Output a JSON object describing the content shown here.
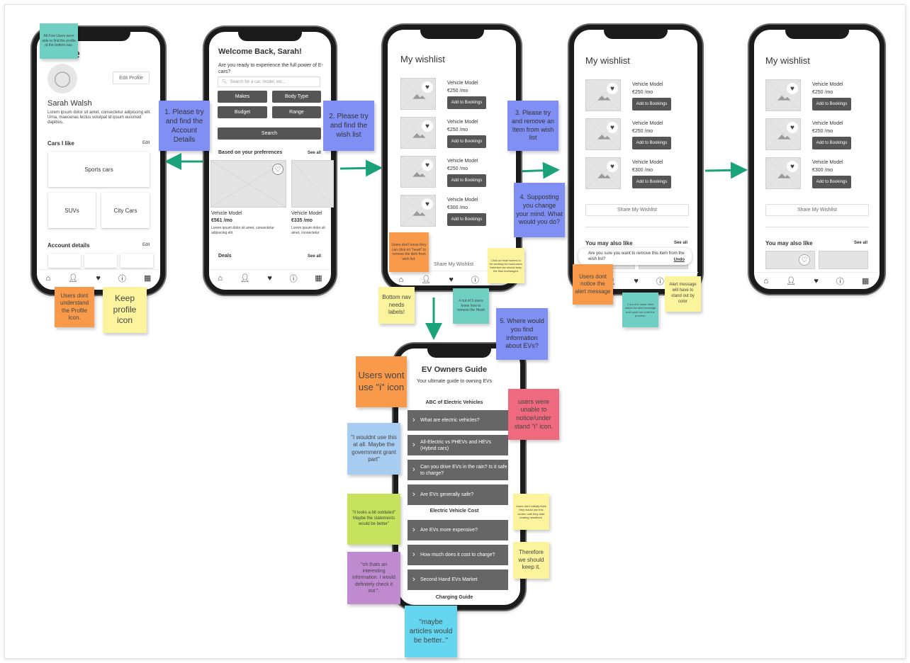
{
  "profile": {
    "title": "Profile",
    "edit_profile": "Edit Profile",
    "name": "Sarah Walsh",
    "bio": "Lorem ipsum dolor sit amet, consectetur adipiscing elit. Urna, maecenas lectus volutpat id ipsum euismod dapibus.",
    "cars_i_like": "Cars I like",
    "edit": "Edit",
    "sports": "Sports cars",
    "suvs": "SUVs",
    "city": "City Cars",
    "account": "Account details",
    "edit2": "Edit"
  },
  "home": {
    "title": "Welcome Back, Sarah!",
    "subtitle": "Are you ready to experience the full power of E-cars?",
    "search_placeholder": "Search for a car, model, etc...",
    "makes": "Makes",
    "body_type": "Body Type",
    "budget": "Budget",
    "range": "Range",
    "search": "Search",
    "prefs": "Based on your preferences",
    "see_all": "See all",
    "cars": [
      {
        "model": "Vehicle Model",
        "price": "€561 /mo",
        "desc": "Lorem ipsum dolor sit amet, consectetur adipiscing elit."
      },
      {
        "model": "Vehicle Model",
        "price": "€335 /mo",
        "desc": "Lorem ipsum dolor sit amet, consectetur adipiscing elit."
      }
    ],
    "deals": "Deals",
    "see_all2": "See all"
  },
  "wishlist": {
    "title": "My wishlist",
    "model": "Vehicle Model",
    "add": "Add to Bookings",
    "prices1": [
      "€250 /mo",
      "€250 /mo",
      "€250 /mo",
      "€300 /mo"
    ],
    "prices2": [
      "€250 /mo",
      "€250 /mo",
      "€300 /mo"
    ],
    "share": "Share My Wishlist",
    "also_like": "You may also like",
    "see_all": "See all",
    "toast": "Are you sure you want to remove this item from the wish list?",
    "undo": "Undo"
  },
  "guide": {
    "title": "EV Owners Guide",
    "subtitle": "Your ultimate guide to owning EVs",
    "sec1": "ABC of Electric Vehicles",
    "items1": [
      "What are electric vehicles?",
      "All-Electric vs PHEVs and HEVs (Hybrid cars)",
      "Can you drive EVs in the rain? Is it safe to charge?",
      "Are EVs generally safe?"
    ],
    "sec2": "Electric Vehicle Cost",
    "items2": [
      "Are EVs more expensive?",
      "How much does it cost to charge?",
      "Second Hand EVs Market"
    ],
    "sec3": "Charging Guide"
  },
  "nav_icons": [
    "home-icon",
    "profile-icon",
    "heart-icon",
    "info-icon",
    "calendar-icon"
  ],
  "notes": {
    "n1": "All Five Users were able to find the profile at the bottom nav.",
    "t1": "1. Please try and find the Account Details",
    "t2": "2. Please try and find the wish list",
    "t3": "3. Please try and remove an Item from wish list",
    "t4": "4. Supposting you change your mind. What would you do?",
    "t5": "5. Where would you find information about EVs?",
    "n2": "Users dont understand the Profile Icon.",
    "n3": "Keep profile icon",
    "n4": "Users don't know they can click on \"heart\" to remove the item from wish list.",
    "n5": "Click on heart seems to be working for most users therefore we should keep the flow unchanged.",
    "n6": "Bottom nav needs labels!",
    "n7": "4 out of 5 users knew how to remove the Heart",
    "n8": "Users dont notice the alert message",
    "n9": "3 out of 5 users didnt notice the alert message and could not undo the process.",
    "n10": "Alert message will have to stand out by color",
    "n11": "Users wont use \"i\" icon",
    "n12": "users were unable to notice/under stand \"i\" icon.",
    "n13": "\"I wouldnt use this at all. Maybe the government grant part\"",
    "n14": "\"it looks a bit outdated\" Maybe the statements would be better\"",
    "n15": "\"oh thats an interesting information. I would definitely check it out.\".",
    "n16": "Users don't initially think they would use this screen until they start reading headlines.",
    "n17": "Therefore we should keep it.",
    "n18": "\"maybe articles would be better..\""
  },
  "colors": {
    "task_note": "#7f8ff4",
    "finding_note": "#f99a4b",
    "insight_note": "#fbf49c",
    "stat_note": "#6fcfc3",
    "arrow": "#1aa37a"
  }
}
